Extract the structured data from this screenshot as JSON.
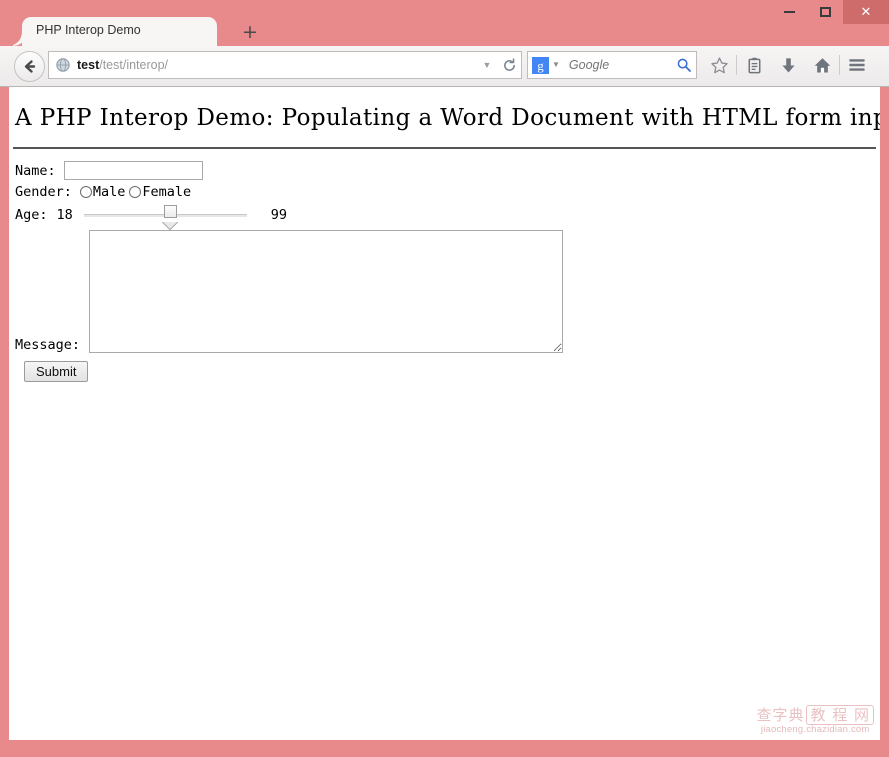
{
  "window": {
    "controls": {
      "minimize": "–",
      "maximize": "□",
      "close": "✕"
    },
    "chrome_color": "#e8898b",
    "close_button_color": "#ce6b6b"
  },
  "tabs": {
    "active_title": "PHP Interop Demo",
    "new_tab_label": "+"
  },
  "toolbar": {
    "back_icon": "back-arrow-icon",
    "url": {
      "host": "test",
      "path": "/test/interop/",
      "identity_icon": "globe-icon",
      "dropdown_icon": "▼",
      "reload_icon": "reload-icon"
    },
    "search": {
      "engine_logo_letter": "g",
      "engine_logo_color": "#4285f4",
      "engine_dropdown_icon": "▼",
      "placeholder": "Google",
      "submit_icon": "magnifier-icon"
    },
    "icons": [
      {
        "name": "bookmark-star-icon",
        "label": "Bookmark"
      },
      {
        "name": "reading-list-icon",
        "label": "Reading list"
      },
      {
        "name": "downloads-icon",
        "label": "Downloads"
      },
      {
        "name": "home-icon",
        "label": "Home"
      },
      {
        "name": "menu-hamburger-icon",
        "label": "Menu"
      }
    ]
  },
  "page": {
    "heading": "A PHP Interop Demo: Populating a Word Document with HTML form input",
    "form": {
      "name": {
        "label": "Name:",
        "value": "",
        "placeholder": ""
      },
      "gender": {
        "label": "Gender:",
        "options": [
          {
            "label": "Male",
            "checked": false
          },
          {
            "label": "Female",
            "checked": false
          }
        ]
      },
      "age": {
        "label": "Age:",
        "min": "18",
        "max": "99",
        "value": "57"
      },
      "message": {
        "label": "Message:",
        "value": "",
        "placeholder": ""
      },
      "submit": {
        "label": "Submit"
      }
    }
  },
  "watermark": {
    "logo_left": "查字典",
    "logo_right": "教 程 网",
    "url": "jiaocheng.chazidian.com"
  }
}
